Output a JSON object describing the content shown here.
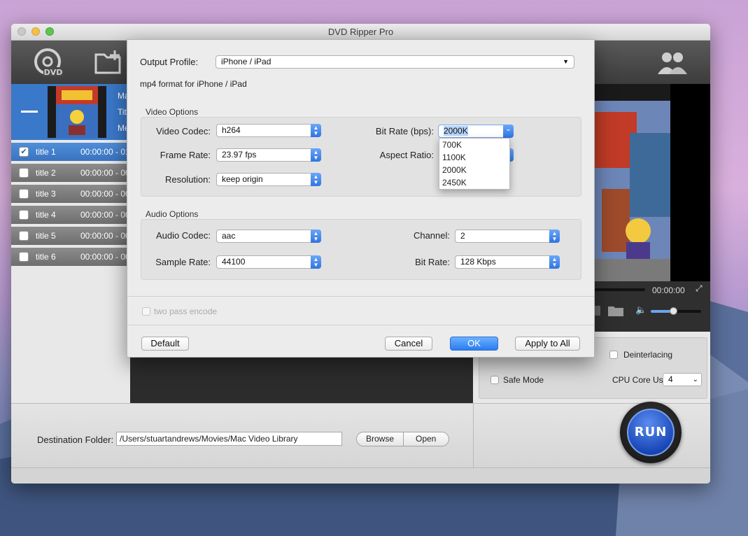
{
  "window": {
    "title": "DVD Ripper Pro"
  },
  "source": {
    "line1": "Ma",
    "line2": "Tit",
    "line3": "Me"
  },
  "titles": [
    {
      "name": "title 1",
      "time": "00:00:00 - 01",
      "checked": true
    },
    {
      "name": "title 2",
      "time": "00:00:00 - 00",
      "checked": false
    },
    {
      "name": "title 3",
      "time": "00:00:00 - 00",
      "checked": false
    },
    {
      "name": "title 4",
      "time": "00:00:00 - 00",
      "checked": false
    },
    {
      "name": "title 5",
      "time": "00:00:00 - 00",
      "checked": false
    },
    {
      "name": "title 6",
      "time": "00:00:00 - 00",
      "checked": false
    }
  ],
  "player": {
    "time": "00:00:00",
    "volume": 0.45
  },
  "options": {
    "deinterlacing": "Deinterlacing",
    "safe_mode": "Safe Mode",
    "cpu_core_label": "CPU Core Use:",
    "cpu_core_value": "4"
  },
  "bottom": {
    "dest_label": "Destination Folder:",
    "dest_value": "/Users/stuartandrews/Movies/Mac Video Library",
    "browse": "Browse",
    "open": "Open",
    "run": "RUN"
  },
  "dialog": {
    "output_profile_label": "Output Profile:",
    "output_profile_value": "iPhone / iPad",
    "profile_desc": "mp4 format for iPhone / iPad",
    "video_options_title": "Video Options",
    "video_codec_label": "Video Codec:",
    "video_codec_value": "h264",
    "frame_rate_label": "Frame Rate:",
    "frame_rate_value": "23.97 fps",
    "resolution_label": "Resolution:",
    "resolution_value": "keep origin",
    "bit_rate_label": "Bit Rate (bps):",
    "bit_rate_value": "2000K",
    "aspect_ratio_label": "Aspect Ratio:",
    "bit_rate_options": [
      "700K",
      "1100K",
      "2000K",
      "2450K"
    ],
    "audio_options_title": "Audio Options",
    "audio_codec_label": "Audio Codec:",
    "audio_codec_value": "aac",
    "sample_rate_label": "Sample Rate:",
    "sample_rate_value": "44100",
    "channel_label": "Channel:",
    "channel_value": "2",
    "audio_bit_rate_label": "Bit Rate:",
    "audio_bit_rate_value": "128 Kbps",
    "two_pass": "two pass encode",
    "default_btn": "Default",
    "cancel_btn": "Cancel",
    "ok_btn": "OK",
    "apply_all_btn": "Apply to All"
  }
}
